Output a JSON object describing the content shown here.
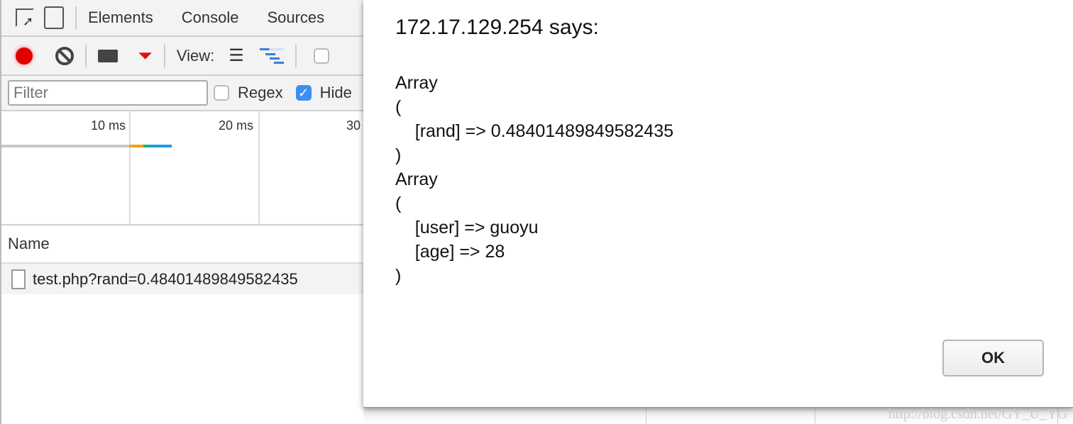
{
  "devtools": {
    "tabs": [
      "Elements",
      "Console",
      "Sources"
    ],
    "toolbar": {
      "view_label": "View:",
      "record_color": "#e00000",
      "filter_color": "#d11"
    },
    "filter": {
      "placeholder": "Filter",
      "value": ""
    },
    "regex_label": "Regex",
    "regex_checked": false,
    "hide_label": "Hide",
    "hide_checked": true,
    "timeline": {
      "ticks": [
        "10 ms",
        "20 ms",
        "30"
      ]
    },
    "name_header": "Name",
    "requests": [
      "test.php?rand=0.48401489849582435"
    ]
  },
  "dialog": {
    "title": "172.17.129.254 says:",
    "message": "Array\n(\n    [rand] => 0.48401489849582435\n)\nArray\n(\n    [user] => guoyu\n    [age] => 28\n)",
    "ok_label": "OK"
  },
  "watermark": "http://blog.csdn.net/GY_U_YG"
}
